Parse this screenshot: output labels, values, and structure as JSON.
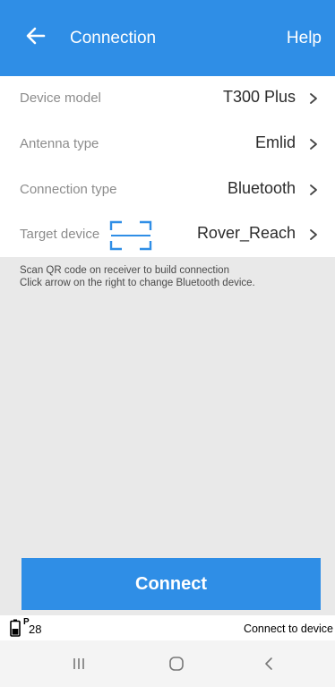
{
  "colors": {
    "header_bg": "#2f8ee6",
    "button_bg": "#2f8ee6",
    "qr_icon": "#2f8ee6",
    "content_bg": "#e9e9e9"
  },
  "header": {
    "back_icon": "arrow-left-icon",
    "title": "Connection",
    "help_label": "Help"
  },
  "rows": [
    {
      "label": "Device model",
      "value": "T300 Plus",
      "chevron": ">"
    },
    {
      "label": "Antenna type",
      "value": "Emlid",
      "chevron": ">"
    },
    {
      "label": "Connection type",
      "value": "Bluetooth",
      "chevron": ">"
    },
    {
      "label": "Target device",
      "value": "Rover_Reach",
      "chevron": ">",
      "icon": "qr-scan-icon"
    }
  ],
  "info": {
    "line1": "Scan QR code on receiver to build connection",
    "line2": "Click arrow on the right to change Bluetooth device."
  },
  "connect_button": {
    "label": "Connect"
  },
  "status_bar": {
    "battery_icon": "battery-icon",
    "sat_badge": "P",
    "sat_count": "28",
    "message": "Connect to device"
  },
  "navbar": {
    "recent_icon": "recent-apps-icon",
    "home_icon": "home-icon",
    "back_icon": "back-chevron-icon"
  }
}
